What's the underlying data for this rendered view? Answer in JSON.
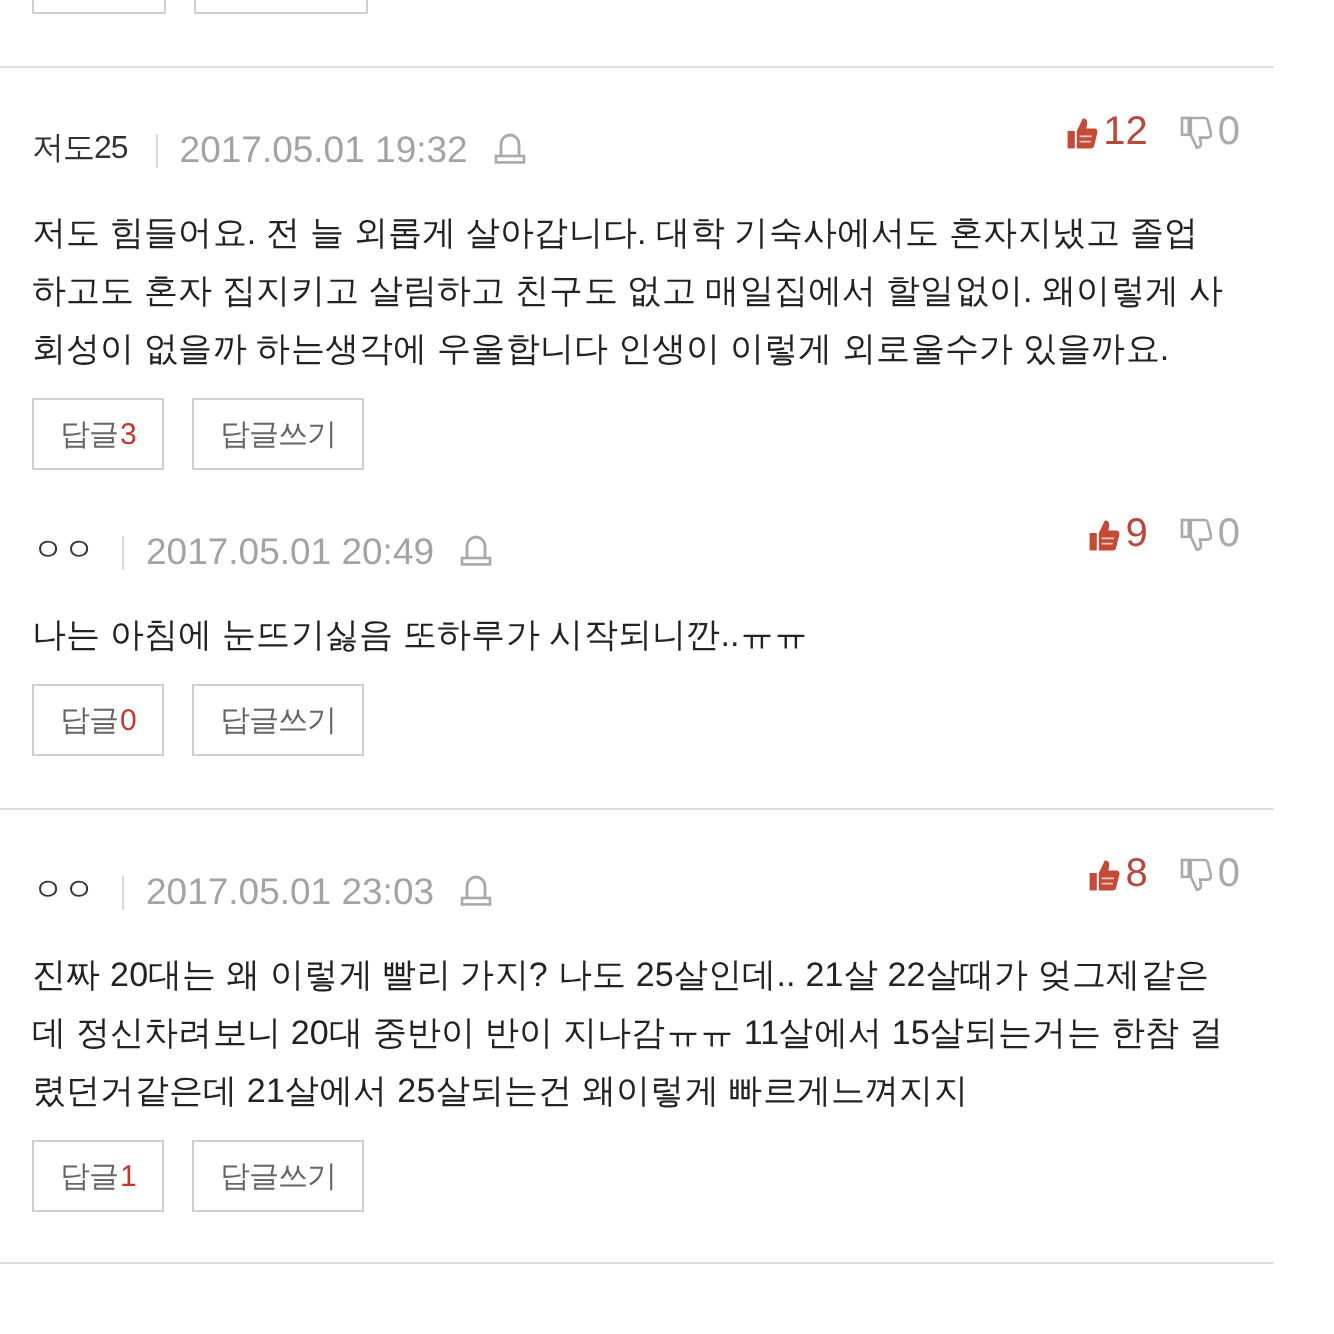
{
  "comments": [
    {
      "divider_above": true,
      "author": "저도25",
      "date": "2017.05.01 19:32",
      "likes": "12",
      "dislikes": "0",
      "text": "저도 힘들어요. 전 늘 외롭게 살아갑니다. 대학 기숙사에서도 혼자지냈고 졸업하고도 혼자 집지키고 살림하고 친구도 없고 매일집에서 할일없이. 왜이렇게 사회성이 없을까 하는생각에 우울합니다 인생이 이렇게 외로울수가 있을까요.",
      "reply_button": {
        "label": "답글",
        "count": "3"
      },
      "write_button": "답글쓰기"
    },
    {
      "divider_above": false,
      "author": "ㅇㅇ",
      "date": "2017.05.01 20:49",
      "likes": "9",
      "dislikes": "0",
      "text": "나는 아침에 눈뜨기싫음 또하루가 시작되니깐..ㅠㅠ",
      "reply_button": {
        "label": "답글",
        "count": "0"
      },
      "write_button": "답글쓰기"
    },
    {
      "divider_above": true,
      "author": "ㅇㅇ",
      "date": "2017.05.01 23:03",
      "likes": "8",
      "dislikes": "0",
      "text": "진짜 20대는 왜 이렇게 빨리 가지? 나도 25살인데.. 21살 22살때가 엊그제같은데 정신차려보니 20대 중반이 반이 지나감ㅠㅠ 11살에서 15살되는거는 한참 걸렸던거같은데 21살에서 25살되는건 왜이렇게 빠르게느껴지지",
      "reply_button": {
        "label": "답글",
        "count": "1"
      },
      "write_button": "답글쓰기"
    }
  ]
}
